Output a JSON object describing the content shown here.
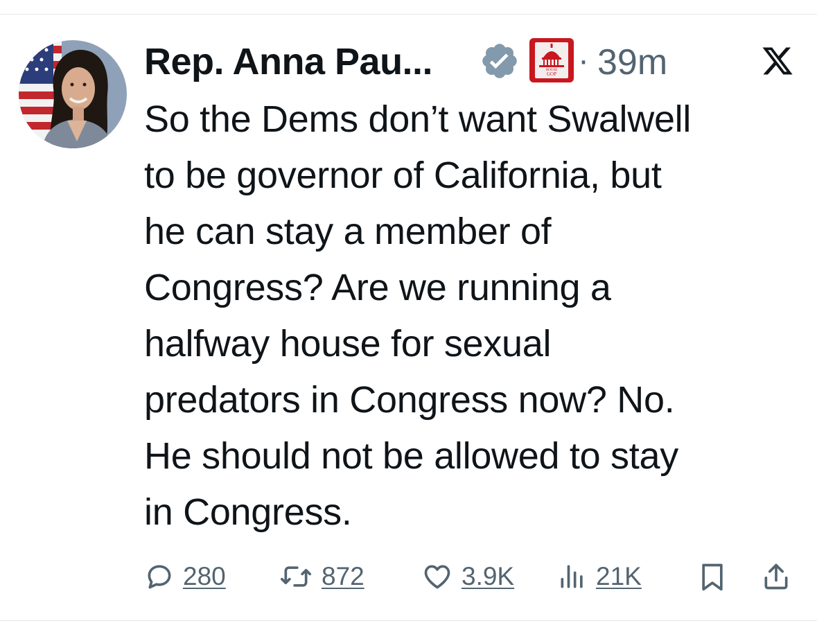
{
  "tweet": {
    "author_name": "Rep. Anna Pau...",
    "time": "39m",
    "dot": "·",
    "affiliation_badge_text": "HOUSE GOP",
    "lines": [
      "So the Dems don’t want Swalwell",
      "to be governor of California, but",
      "he can stay a member of",
      "Congress? Are we running a",
      "halfway house for sexual",
      "predators in Congress now? No.",
      "He should not be allowed to stay",
      "in Congress."
    ]
  },
  "actions": {
    "replies": "280",
    "reposts": "872",
    "likes": "3.9K",
    "views": "21K"
  },
  "icons": {
    "verified": "verified-badge-icon",
    "affiliation": "house-gop-capitol-icon",
    "platform": "x-logo-icon",
    "reply": "reply-bubble-icon",
    "repost": "repost-arrows-icon",
    "like": "heart-icon",
    "views": "views-bars-icon",
    "bookmark": "bookmark-icon",
    "share": "share-icon"
  },
  "colors": {
    "text": "#0f1419",
    "muted": "#536471",
    "verified_badge": "#829aab",
    "affiliation_red": "#c8171e"
  }
}
